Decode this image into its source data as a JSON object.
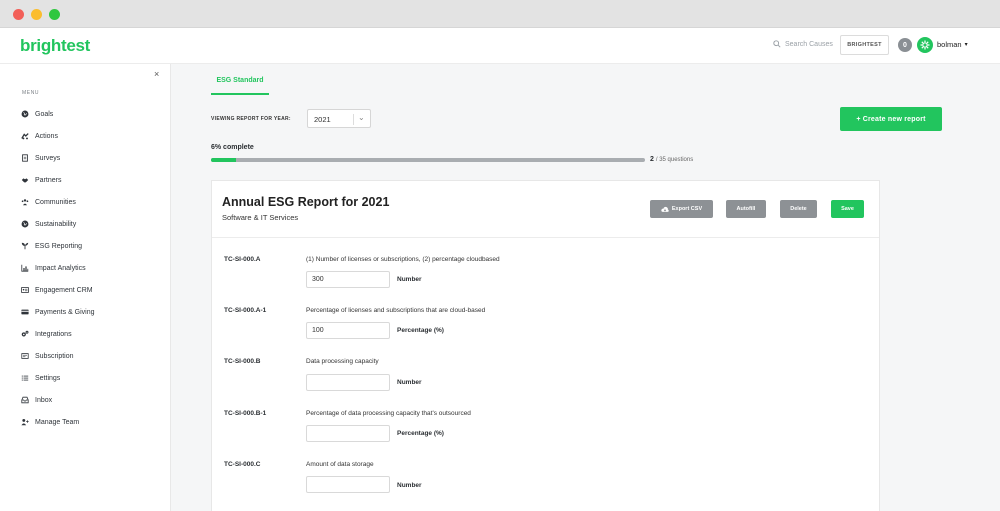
{
  "app": {
    "logo": "brightest"
  },
  "header": {
    "search_placeholder": "Search Causes",
    "brand_button": "BRIGHTEST",
    "notification_count": "0",
    "username": "bolman",
    "accent_color": "#22c55e"
  },
  "sidebar": {
    "close_icon": "×",
    "menu_title": "MENU",
    "items": [
      {
        "label": "Goals",
        "icon": "globe-icon"
      },
      {
        "label": "Actions",
        "icon": "hands-icon"
      },
      {
        "label": "Surveys",
        "icon": "document-icon"
      },
      {
        "label": "Partners",
        "icon": "handshake-icon"
      },
      {
        "label": "Communities",
        "icon": "people-icon"
      },
      {
        "label": "Sustainability",
        "icon": "globe-icon"
      },
      {
        "label": "ESG Reporting",
        "icon": "seedling-icon"
      },
      {
        "label": "Impact Analytics",
        "icon": "chart-icon"
      },
      {
        "label": "Engagement CRM",
        "icon": "id-card-icon"
      },
      {
        "label": "Payments & Giving",
        "icon": "credit-card-icon"
      },
      {
        "label": "Integrations",
        "icon": "cogs-icon"
      },
      {
        "label": "Subscription",
        "icon": "receipt-icon"
      },
      {
        "label": "Settings",
        "icon": "list-icon"
      },
      {
        "label": "Inbox",
        "icon": "inbox-icon"
      },
      {
        "label": "Manage Team",
        "icon": "user-plus-icon"
      }
    ]
  },
  "main": {
    "tab_label": "ESG Standard",
    "year_label": "VIEWING REPORT FOR YEAR:",
    "year_value": "2021",
    "create_button": "+ Create new report",
    "progress": {
      "percent_text": "6% complete",
      "fraction": 0.057,
      "answered": "2",
      "total_text": "/ 35 questions"
    }
  },
  "report": {
    "title": "Annual ESG Report for 2021",
    "subtitle": "Software & IT Services",
    "buttons": {
      "export": "Export CSV",
      "autofill": "Autofill",
      "delete": "Delete",
      "save": "Save"
    },
    "questions": [
      {
        "code": "TC-SI-000.A",
        "text": "(1) Number of licenses or subscriptions, (2) percentage cloudbased",
        "value": "300",
        "unit": "Number"
      },
      {
        "code": "TC-SI-000.A-1",
        "text": "Percentage of licenses and subscriptions that are cloud-based",
        "value": "100",
        "unit": "Percentage (%)"
      },
      {
        "code": "TC-SI-000.B",
        "text": "Data processing capacity",
        "value": "",
        "unit": "Number"
      },
      {
        "code": "TC-SI-000.B-1",
        "text": "Percentage of data processing capacity that's outsourced",
        "value": "",
        "unit": "Percentage (%)"
      },
      {
        "code": "TC-SI-000.C",
        "text": "Amount of data storage",
        "value": "",
        "unit": "Number"
      }
    ]
  }
}
